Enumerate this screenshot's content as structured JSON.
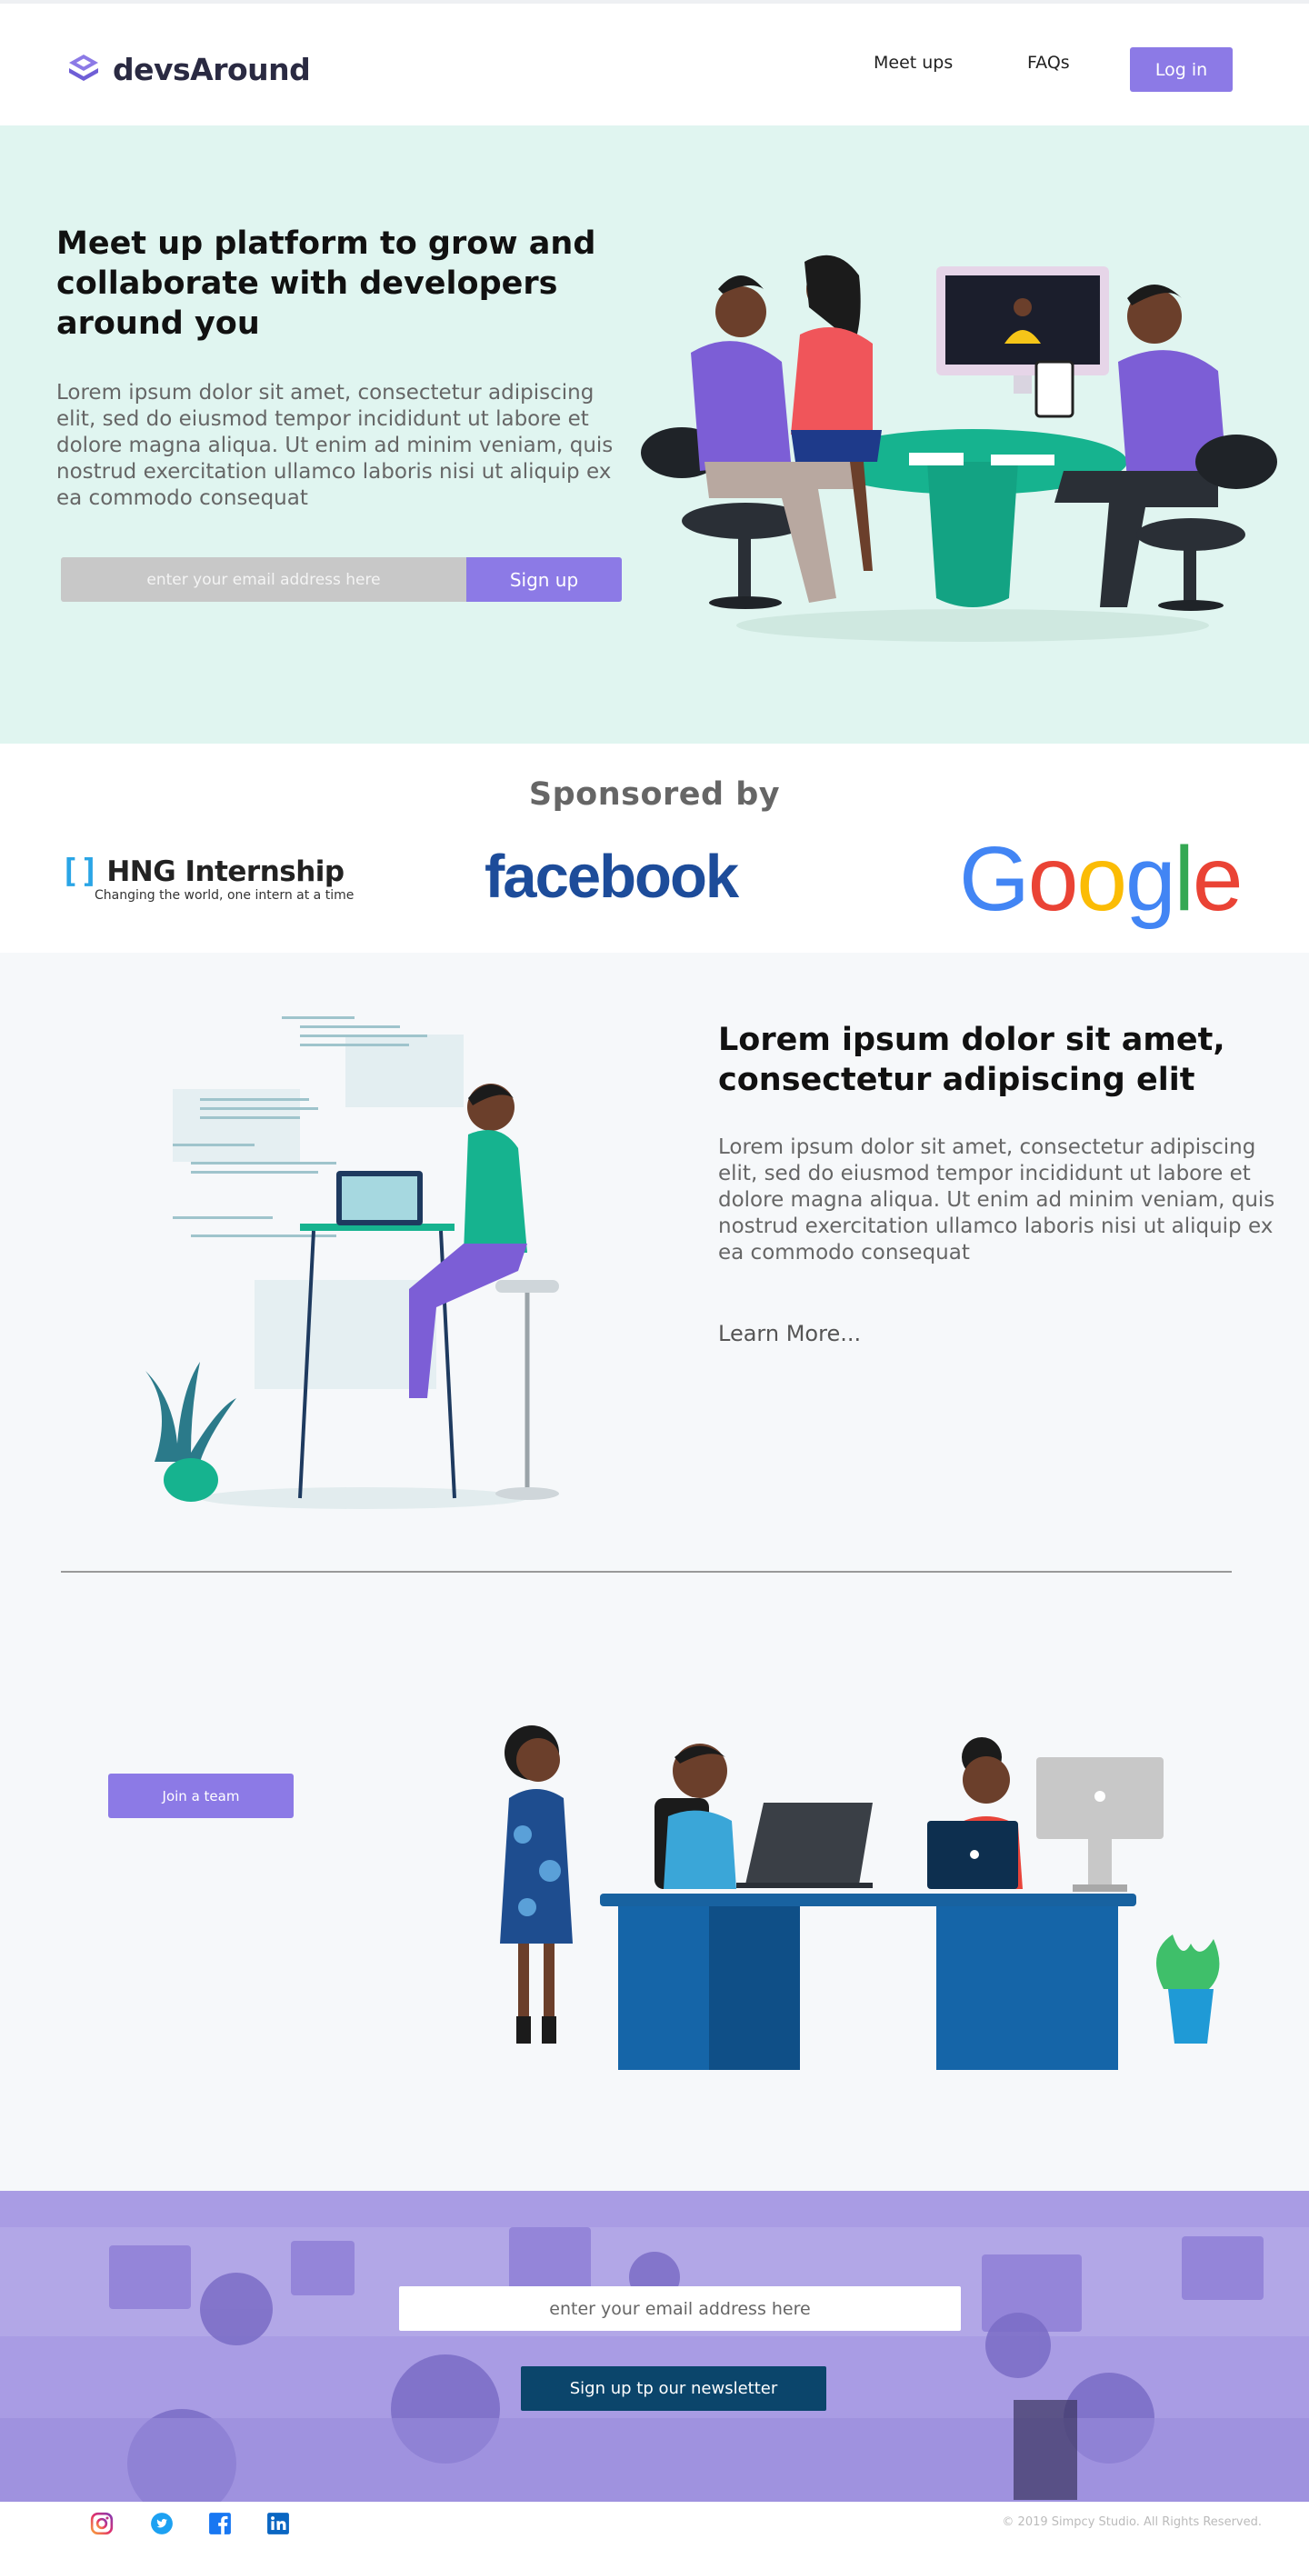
{
  "nav": {
    "brand": "devsAround",
    "links": [
      "Meet ups",
      "FAQs"
    ],
    "login_label": "Log in"
  },
  "hero": {
    "title": "Meet up platform to grow and collaborate with developers around you",
    "text": "Lorem ipsum dolor sit amet, consectetur adipiscing elit, sed do eiusmod tempor incididunt ut labore et dolore magna aliqua. Ut enim ad minim veniam, quis nostrud exercitation ullamco laboris nisi ut aliquip ex ea commodo consequat",
    "email_placeholder": "enter your email address here",
    "signup_label": "Sign up"
  },
  "sponsors": {
    "title": "Sponsored  by",
    "hng_bracket": "[]",
    "hng_name": "HNG Internship",
    "hng_tagline": "Changing the world, one intern at a time",
    "facebook": "facebook",
    "google_letters": [
      "G",
      "o",
      "o",
      "g",
      "l",
      "e"
    ],
    "google_colors": [
      "#4285F4",
      "#EA4335",
      "#FBBC05",
      "#4285F4",
      "#34A853",
      "#EA4335"
    ]
  },
  "feature": {
    "title": "Lorem ipsum dolor sit amet, consectetur adipiscing elit",
    "text": "Lorem ipsum dolor sit amet, consectetur adipiscing elit, sed do eiusmod tempor incididunt ut labore et dolore magna aliqua. Ut enim ad minim veniam, quis nostrud exercitation ullamco laboris nisi ut aliquip ex ea commodo consequat",
    "learn_more": "Learn More...",
    "join_label": "Join a team"
  },
  "newsletter": {
    "email_placeholder": "enter your email address here",
    "button_label": "Sign up tp our newsletter"
  },
  "footer": {
    "social_icons": [
      "instagram-icon",
      "twitter-icon",
      "facebook-icon",
      "linkedin-icon"
    ],
    "copyright": "© 2019 Simpcy Studio. All Rights Reserved."
  },
  "colors": {
    "accent": "#8c7ae6",
    "hero_bg": "#e0f5f0",
    "feature_bg": "#f6f8fa",
    "newsletter_btn": "#0b456b",
    "facebook_blue": "#1d4c9a"
  }
}
